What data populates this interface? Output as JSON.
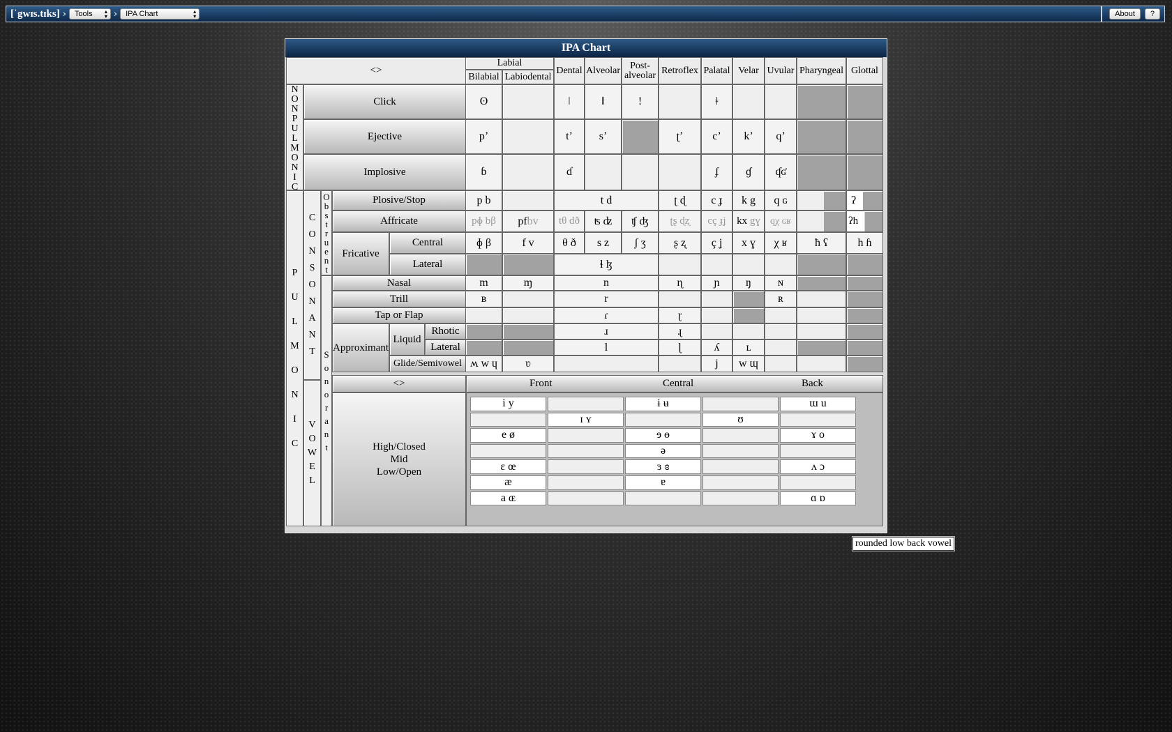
{
  "app": {
    "brand": "[ˈgwɪs.tɪks]"
  },
  "nav": {
    "separator": "›",
    "tools_label": "Tools",
    "page_label": "IPA Chart"
  },
  "topbar": {
    "about_label": "About",
    "help_label": "?"
  },
  "chart": {
    "title": "IPA Chart",
    "corner": "<>",
    "groups": {
      "labial": "Labial"
    },
    "places": {
      "bilabial": "Bilabial",
      "labiodental": "Labiodental",
      "dental": "Dental",
      "alveolar": "Alveolar",
      "postalveolar_1": "Post-",
      "postalveolar_2": "alveolar",
      "retroflex": "Retroflex",
      "palatal": "Palatal",
      "velar": "Velar",
      "uvular": "Uvular",
      "pharyngeal": "Pharyngeal",
      "glottal": "Glottal"
    },
    "side": {
      "nonpulmonic": "NONPULMONIC",
      "pulmonic": "PULMONIC",
      "consonant": "CONSONANT",
      "vowel": "VOWEL",
      "obstruent": "Obstruent",
      "sonorant": "Sonorant"
    },
    "manners": {
      "click": "Click",
      "ejective": "Ejective",
      "implosive": "Implosive",
      "plosive": "Plosive/Stop",
      "affricate": "Affricate",
      "fricative": "Fricative",
      "central": "Central",
      "lateral": "Lateral",
      "nasal": "Nasal",
      "trill": "Trill",
      "tap": "Tap or Flap",
      "approximant": "Approximant",
      "liquid": "Liquid",
      "rhotic": "Rhotic",
      "approx_lateral": "Lateral",
      "glide": "Glide/Semivowel"
    },
    "cells": {
      "click_bilabial": "ʘ",
      "click_dental": "ǀ",
      "click_alveolar": "ǁ",
      "click_postalveolar": "!",
      "click_palatal": "ǂ",
      "ej_bilabial": "p’",
      "ej_dental": "t’",
      "ej_alveolar": "s’",
      "ej_retroflex": "ʈ’",
      "ej_palatal": "c’",
      "ej_velar": "k’",
      "ej_uvular": "q’",
      "imp_bilabial": "ɓ",
      "imp_dental": "ɗ",
      "imp_palatal": "ʄ",
      "imp_velar": "ɠ",
      "imp_uvular": "ʠʛ",
      "plo_bilabial": "p b",
      "plo_alveolar": "t d",
      "plo_retroflex": "ʈ ɖ",
      "plo_palatal": "c ɟ",
      "plo_velar": "k g",
      "plo_uvular": "q ɢ",
      "plo_glottal": "ʔ",
      "aff_bilabial": "pɸ bβ",
      "aff_labiodental_a": "pf",
      "aff_labiodental_b": "bv",
      "aff_dental": "tθ dð",
      "aff_alveolar": "ʦ ʣ",
      "aff_postalveolar": "ʧ ʤ",
      "aff_retroflex": "ʈʂ ɖʐ",
      "aff_palatal": "cç ɟʝ",
      "aff_velar_a": "kx",
      "aff_velar_b": "gɣ",
      "aff_uvular": "qχ ɢʁ",
      "aff_glottal": "ʔh",
      "fri_bilabial": "ɸ β",
      "fri_labiodental": "f v",
      "fri_dental": "θ ð",
      "fri_alveolar": "s z",
      "fri_postalveolar": "ʃ ʒ",
      "fri_retroflex": "ʂ ʐ",
      "fri_palatal": "ç ʝ",
      "fri_velar": "x ɣ",
      "fri_uvular": "χ ʁ",
      "fri_pharyngeal": "ħ ʕ",
      "fri_glottal": "h ɦ",
      "latfri_alveolar": "ɬ ɮ",
      "nas_bilabial": "m",
      "nas_labiodental": "ɱ",
      "nas_alveolar": "n",
      "nas_retroflex": "ɳ",
      "nas_palatal": "ɲ",
      "nas_velar": "ŋ",
      "nas_uvular": "ɴ",
      "tri_bilabial": "ʙ",
      "tri_alveolar": "r",
      "tri_uvular": "ʀ",
      "tap_alveolar": "ɾ",
      "tap_retroflex": "ɽ",
      "rho_alveolar": "ɹ",
      "rho_retroflex": "ɻ",
      "lat_alveolar": "l",
      "lat_retroflex": "ɭ",
      "lat_palatal": "ʎ",
      "lat_velar": "ʟ",
      "gli_bilabial": "ʍ w ɥ",
      "gli_labiodental": "ʋ",
      "gli_palatal": "j",
      "gli_velar": "w ɰ"
    },
    "vowels": {
      "corner": "<>",
      "front": "Front",
      "central": "Central",
      "back": "Back",
      "height_1": "High/Closed",
      "height_2": "Mid",
      "height_3": "Low/Open",
      "rows": [
        [
          "i y",
          "",
          "ɨ ʉ",
          "",
          "ɯ u"
        ],
        [
          "",
          "ɪ ʏ",
          "",
          "ʊ",
          ""
        ],
        [
          "e ø",
          "",
          "ɘ ɵ",
          "",
          "ɤ o"
        ],
        [
          "",
          "",
          "ə",
          "",
          ""
        ],
        [
          "ɛ œ",
          "",
          "ɜ ɞ",
          "",
          "ʌ ɔ"
        ],
        [
          "æ",
          "",
          "ɐ",
          "",
          ""
        ],
        [
          "a ɶ",
          "",
          "",
          "",
          "ɑ ɒ"
        ]
      ]
    }
  },
  "tooltip": {
    "text": "rounded low back vowel"
  }
}
